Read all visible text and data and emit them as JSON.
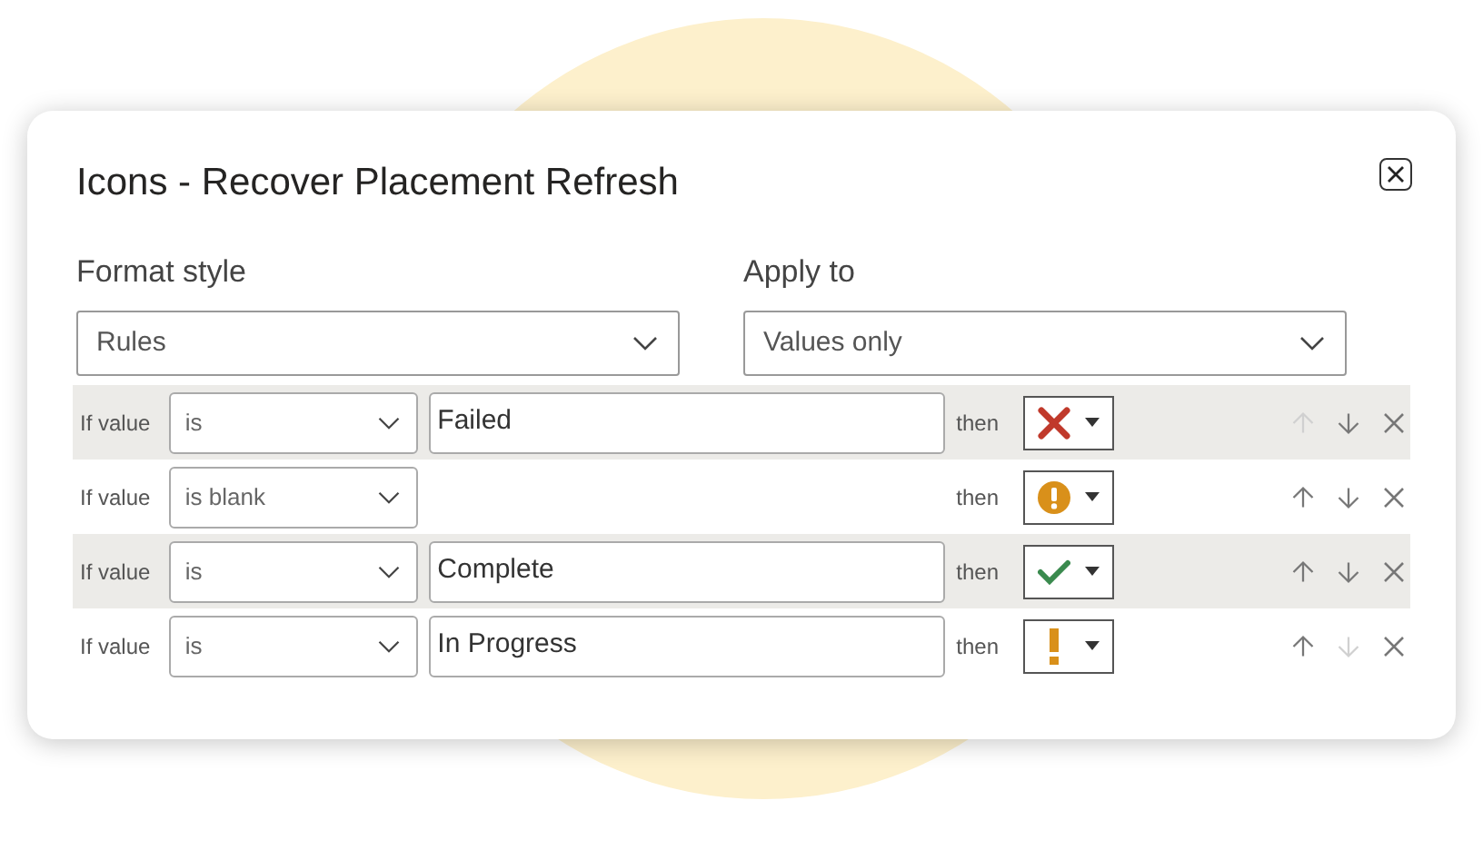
{
  "dialog": {
    "title": "Icons - Recover Placement Refresh"
  },
  "format_style": {
    "label": "Format style",
    "value": "Rules"
  },
  "apply_to": {
    "label": "Apply to",
    "value": "Values only"
  },
  "rules": [
    {
      "prefix": "If value",
      "condition": "is",
      "value": "Failed",
      "then": "then",
      "icon": {
        "kind": "cross",
        "color": "#c0392b"
      },
      "up_disabled": true,
      "down_disabled": false
    },
    {
      "prefix": "If value",
      "condition": "is blank",
      "then": "then",
      "icon": {
        "kind": "circle-exclamation",
        "color": "#d9901a"
      },
      "up_disabled": false,
      "down_disabled": false
    },
    {
      "prefix": "If value",
      "condition": "is",
      "value": "Complete",
      "then": "then",
      "icon": {
        "kind": "check",
        "color": "#3a8a4e"
      },
      "up_disabled": false,
      "down_disabled": false
    },
    {
      "prefix": "If value",
      "condition": "is",
      "value": "In Progress",
      "then": "then",
      "icon": {
        "kind": "exclamation",
        "color": "#d9901a"
      },
      "up_disabled": false,
      "down_disabled": true
    }
  ]
}
